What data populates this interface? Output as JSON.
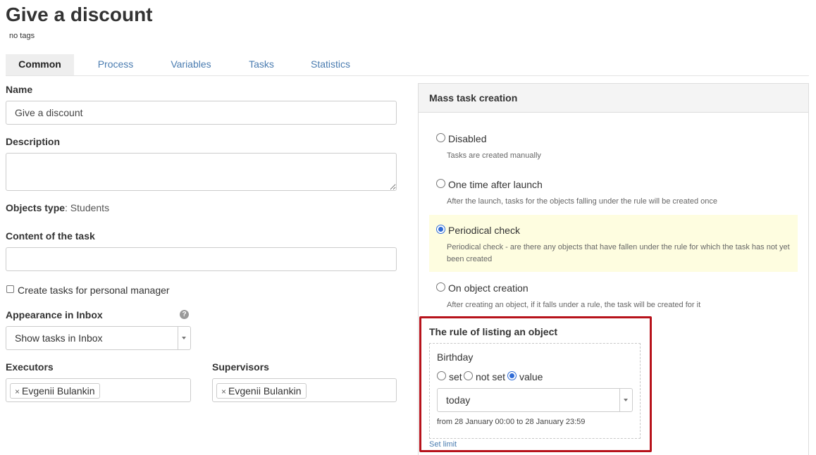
{
  "page": {
    "title": "Give a discount",
    "tags": "no tags"
  },
  "tabs": [
    {
      "label": "Common",
      "active": true
    },
    {
      "label": "Process",
      "active": false
    },
    {
      "label": "Variables",
      "active": false
    },
    {
      "label": "Tasks",
      "active": false
    },
    {
      "label": "Statistics",
      "active": false
    }
  ],
  "form": {
    "name_label": "Name",
    "name_value": "Give a discount",
    "description_label": "Description",
    "description_value": "",
    "objects_type_label": "Objects type",
    "objects_type_value": ": Students",
    "content_label": "Content of the task",
    "content_value": "",
    "personal_manager_label": "Create tasks for personal manager",
    "personal_manager_checked": false,
    "appearance_label": "Appearance in Inbox",
    "appearance_help": "?",
    "appearance_value": "Show tasks in Inbox",
    "executors_label": "Executors",
    "executors": [
      "Evgenii Bulankin"
    ],
    "supervisors_label": "Supervisors",
    "supervisors": [
      "Evgenii Bulankin"
    ],
    "token_remove": "×"
  },
  "mass": {
    "title": "Mass task creation",
    "selected": "periodical",
    "options": [
      {
        "id": "disabled",
        "label": "Disabled",
        "desc": "Tasks are created manually"
      },
      {
        "id": "once",
        "label": "One time after launch",
        "desc": "After the launch, tasks for the objects falling under the rule will be created once"
      },
      {
        "id": "periodical",
        "label": "Periodical check",
        "desc": "Periodical check - are there any objects that have fallen under the rule for which the task has not yet been created"
      },
      {
        "id": "creation",
        "label": "On object creation",
        "desc": "After creating an object, if it falls under a rule, the task will be created for it"
      }
    ]
  },
  "rule": {
    "title": "The rule of listing an object",
    "field": "Birthday",
    "mode_set": "set",
    "mode_not_set": "not set",
    "mode_value": "value",
    "selected_mode": "value",
    "value": "today",
    "range_text": "from 28 January 00:00 to 28 January 23:59",
    "set_limit": "Set limit"
  },
  "colors": {
    "accent_link": "#4a7cb0",
    "radio_selected": "#2f6bd6",
    "highlight_bg": "#fefde0",
    "red_frame": "#b7121b"
  }
}
